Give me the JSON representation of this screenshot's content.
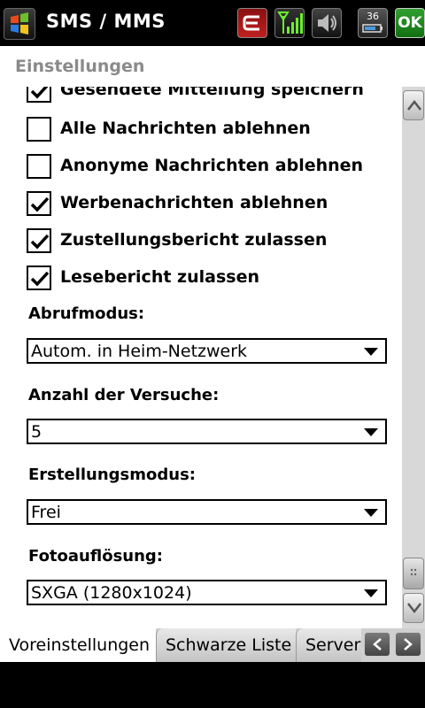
{
  "titlebar": {
    "title": "SMS / MMS",
    "battery_label": "36",
    "ok_label": "OK",
    "icons": [
      "windows-start-icon",
      "edge-network-icon",
      "signal-strength-icon",
      "speaker-icon",
      "battery-icon"
    ]
  },
  "header": {
    "title": "Einstellungen"
  },
  "checkboxes": [
    {
      "label": "Gesendete Mitteilung speichern",
      "checked": true
    },
    {
      "label": "Alle Nachrichten ablehnen",
      "checked": false
    },
    {
      "label": "Anonyme Nachrichten ablehnen",
      "checked": false
    },
    {
      "label": "Werbenachrichten ablehnen",
      "checked": true
    },
    {
      "label": "Zustellungsbericht zulassen",
      "checked": true
    },
    {
      "label": "Lesebericht zulassen",
      "checked": true
    }
  ],
  "fields": [
    {
      "label": "Abrufmodus:",
      "value": "Autom. in Heim-Netzwerk"
    },
    {
      "label": "Anzahl der Versuche:",
      "value": "5"
    },
    {
      "label": "Erstellungsmodus:",
      "value": "Frei"
    },
    {
      "label": "Fotoauflösung:",
      "value": "SXGA (1280x1024)"
    }
  ],
  "tabs": [
    {
      "label": "Voreinstellungen",
      "active": true
    },
    {
      "label": "Schwarze Liste",
      "active": false
    },
    {
      "label": "Server",
      "active": false
    }
  ],
  "colors": {
    "title_bg": "#000000",
    "ok_green": "#1f8a1f",
    "heading_gray": "#8a8a8a"
  }
}
